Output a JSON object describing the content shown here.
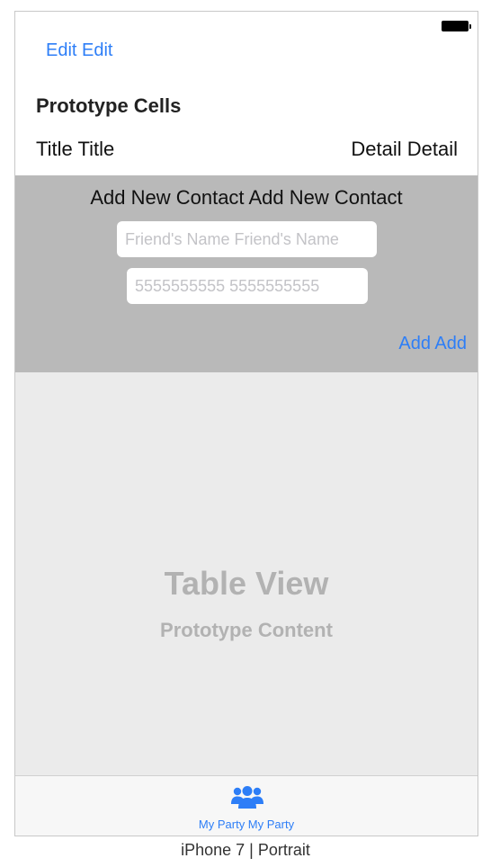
{
  "nav": {
    "edit_label": "Edit Edit"
  },
  "table": {
    "section_header": "Prototype Cells",
    "cell_title": "Title Title",
    "cell_detail": "Detail Detail"
  },
  "add_contact": {
    "title": "Add New Contact Add New Contact",
    "name_placeholder": "Friend's Name Friend's Name",
    "phone_placeholder": "5555555555 5555555555",
    "add_label": "Add Add"
  },
  "table_view": {
    "title": "Table View",
    "subtitle": "Prototype Content"
  },
  "tab_bar": {
    "items": [
      {
        "label": "My Party My Party",
        "icon": "people-icon",
        "selected": true
      }
    ]
  },
  "device_caption": "iPhone 7 | Portrait",
  "colors": {
    "accent": "#2d7ef7",
    "panel": "#b9b9b9",
    "table_background": "#ebebeb",
    "placeholder_text": "#b2b2b2"
  }
}
